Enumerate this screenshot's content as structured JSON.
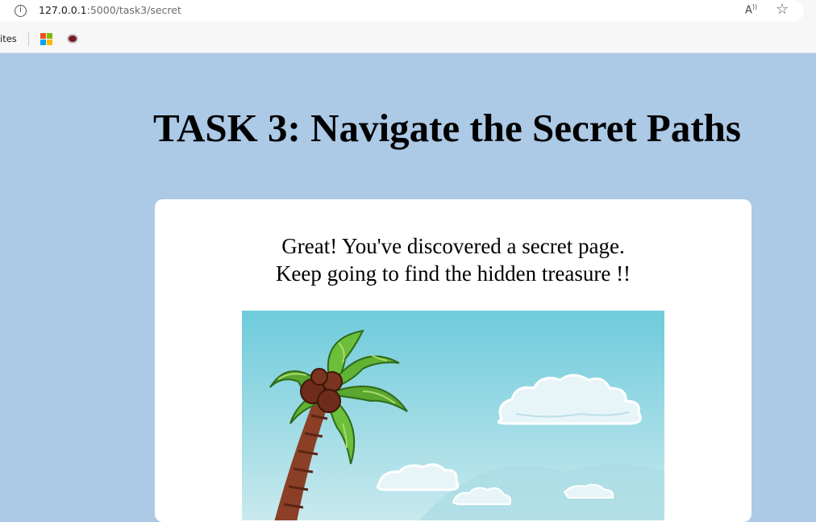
{
  "browser": {
    "url_host": "127.0.0.1",
    "url_path": ":5000/task3/secret",
    "favorites_label": "ites",
    "info_icon": "info-icon",
    "read_aloud_icon": "read-aloud-icon",
    "star_icon": "favorite-star-icon"
  },
  "page": {
    "title": "TASK 3: Navigate the Secret Paths",
    "message_line1": "Great! You've discovered a secret page.",
    "message_line2": "Keep going to find the hidden treasure !!",
    "image_description_icon": "palm-tree-beach-illustration"
  },
  "colors": {
    "page_background": "#acc9e6",
    "card_background": "#ffffff",
    "sky_top": "#6ecbdb",
    "sky_bottom": "#c9e9ee"
  }
}
